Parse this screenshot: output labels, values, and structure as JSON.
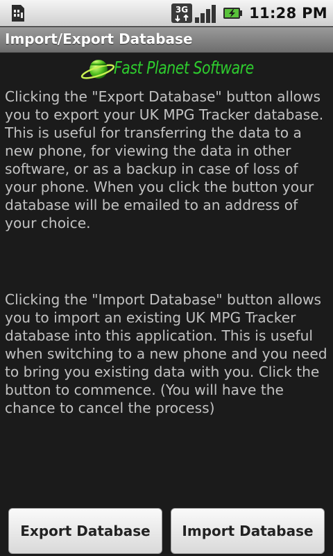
{
  "status_bar": {
    "time": "11:28 PM",
    "network_label": "3G",
    "icons": [
      "sim-card-icon",
      "network-3g-icon",
      "signal-strength-icon",
      "battery-charging-icon"
    ]
  },
  "app": {
    "title": "Import/Export Database"
  },
  "logo": {
    "text": "Fast Planet Software",
    "color": "#2ecc2e"
  },
  "content": {
    "export_description": "Clicking the \"Export Database\" button allows you to export your UK MPG Tracker database. This is useful for transferring the data to a new phone, for viewing the data in other software, or as a backup in case of loss of your phone. When you click the button your database will be emailed to an address of your choice.",
    "import_description": "Clicking the \"Import Database\" button allows you to import an existing UK MPG Tracker database into this application. This is useful when switching to a new phone and you need to bring you existing data with you. Click the button to commence. (You will have the chance to cancel the process)"
  },
  "buttons": {
    "export_label": "Export Database",
    "import_label": "Import Database"
  }
}
